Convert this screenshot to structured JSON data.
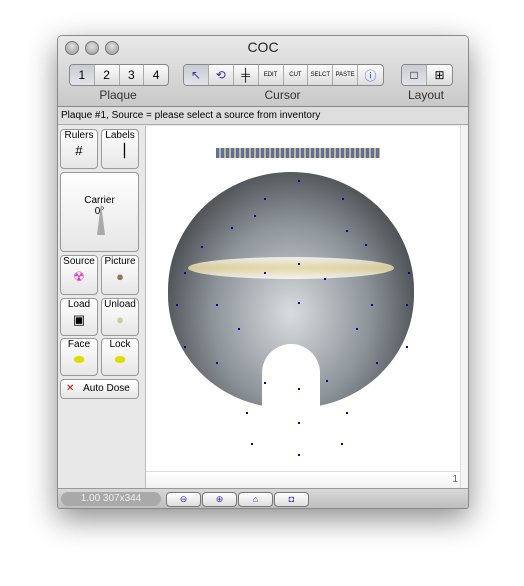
{
  "window": {
    "title": "COC"
  },
  "toolbar": {
    "plaque": {
      "label": "Plaque",
      "items": [
        "1",
        "2",
        "3",
        "4"
      ],
      "selected": "1"
    },
    "cursor": {
      "label": "Cursor",
      "items": [
        {
          "icon": "pointer-icon"
        },
        {
          "icon": "rotate-icon"
        },
        {
          "icon": "move-icon"
        },
        {
          "icon": "edit-icon",
          "text": "EDIT"
        },
        {
          "icon": "cut-icon",
          "text": "CUT"
        },
        {
          "icon": "select-icon",
          "text": "SELCT"
        },
        {
          "icon": "paste-icon",
          "text": "PASTE"
        },
        {
          "icon": "info-icon"
        }
      ]
    },
    "layout": {
      "label": "Layout",
      "items": [
        "single-icon",
        "grid-icon"
      ],
      "selected": "single-icon"
    }
  },
  "status": "Plaque #1, Source = please select a source from inventory",
  "sidebar": {
    "rulers": "Rulers",
    "labels": "Labels",
    "carrier": {
      "label": "Carrier",
      "angle": "0°"
    },
    "source": "Source",
    "picture": "Picture",
    "load": "Load",
    "unload": "Unload",
    "face": "Face",
    "lock": "Lock",
    "auto_dose": "Auto Dose"
  },
  "canvas": {
    "page_number": "1"
  },
  "bottom": {
    "zoom_info": "1.00 307x344",
    "buttons": [
      "zoom-out-icon",
      "zoom-in-icon",
      "home-icon",
      "fit-icon"
    ]
  },
  "colors": {
    "dots": "#0000aa",
    "source": "#e040c0"
  }
}
